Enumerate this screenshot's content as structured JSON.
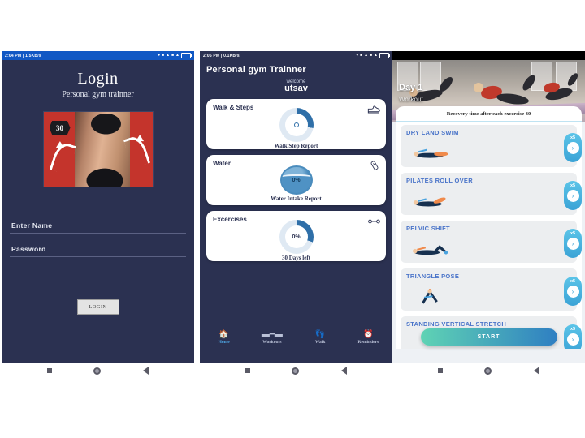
{
  "phones": [
    {
      "id": "login",
      "status": {
        "time_net": "2:04 PM | 1.5KB/s",
        "icons": [
          "wifi-icon",
          "nfc-icon",
          "signal-icon",
          "sim-icon",
          "signal2-icon",
          "battery-icon"
        ]
      },
      "title": "Login",
      "subtitle": "Personal gym trainner",
      "hero": {
        "badge": "30"
      },
      "fields": [
        {
          "name": "name",
          "placeholder": "Enter Name",
          "value": ""
        },
        {
          "name": "password",
          "placeholder": "Password",
          "value": ""
        }
      ],
      "login_button": "LOGIN"
    },
    {
      "id": "dashboard",
      "status": {
        "time_net": "2:05 PM | 0.1KB/s"
      },
      "app_title": "Personal gym Trainner",
      "welcome_label": "welcome",
      "user_name": "utsav",
      "cards": [
        {
          "title": "Walk & Steps",
          "icon": "shoe-icon",
          "ring_value": "",
          "ring_percent": 28,
          "footer": "Walk Step Report"
        },
        {
          "title": "Water",
          "icon": "water-bottle-icon",
          "ring_value": "0%",
          "ring_percent": 0,
          "footer": "Water Intake Report"
        },
        {
          "title": "Excercises",
          "icon": "dumbbell-icon",
          "ring_value": "0%",
          "ring_percent": 30,
          "footer": "30 Days left"
        }
      ],
      "tabs": [
        {
          "label": "Home",
          "icon": "home-icon",
          "active": true
        },
        {
          "label": "Workouts",
          "icon": "dumbbell-icon",
          "active": false
        },
        {
          "label": "Walk",
          "icon": "footsteps-icon",
          "active": false
        },
        {
          "label": "Reminders",
          "icon": "alarm-icon",
          "active": false
        }
      ]
    },
    {
      "id": "workout",
      "status": {
        "time_net": ""
      },
      "day_label": "Day 1",
      "day_sub": "Workout",
      "recovery_text": "Recovery time after each excercise 30",
      "exercises": [
        {
          "name": "DRY LAND SWIM",
          "reps": "x5",
          "chevron": "›"
        },
        {
          "name": "PILATES ROLL OVER",
          "reps": "x5",
          "chevron": "›"
        },
        {
          "name": "PELVIC SHIFT",
          "reps": "x5",
          "chevron": "›"
        },
        {
          "name": "TRIANGLE POSE",
          "reps": "x5",
          "chevron": "›"
        },
        {
          "name": "STANDING VERTICAL STRETCH",
          "reps": "x5",
          "chevron": "›"
        }
      ],
      "start_button": "START"
    }
  ],
  "colors": {
    "navy": "#2b3151",
    "status_blue": "#1158c4",
    "accent_blue": "#4fa9e8",
    "exercise_title": "#4a74c9",
    "start_gradient_from": "#5fd3b4",
    "start_gradient_to": "#2f7fc2",
    "hero_red": "#c4342c",
    "page_background": "#ffffff"
  }
}
